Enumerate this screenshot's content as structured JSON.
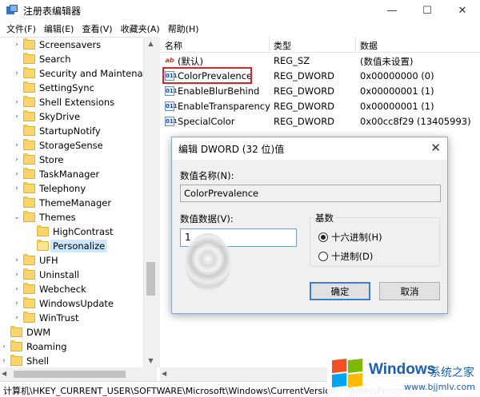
{
  "window": {
    "title": "注册表编辑器",
    "controls": {
      "minimize": "—",
      "maximize": "☐",
      "close": "✕"
    }
  },
  "menu": [
    "文件(F)",
    "编辑(E)",
    "查看(V)",
    "收藏夹(A)",
    "帮助(H)"
  ],
  "tree": {
    "items": [
      {
        "label": "Screensavers",
        "arrow": "›"
      },
      {
        "label": "Search",
        "arrow": ""
      },
      {
        "label": "Security and Maintenance",
        "arrow": "›"
      },
      {
        "label": "SettingSync",
        "arrow": ""
      },
      {
        "label": "Shell Extensions",
        "arrow": "›"
      },
      {
        "label": "SkyDrive",
        "arrow": "›"
      },
      {
        "label": "StartupNotify",
        "arrow": ""
      },
      {
        "label": "StorageSense",
        "arrow": "›"
      },
      {
        "label": "Store",
        "arrow": "›"
      },
      {
        "label": "TaskManager",
        "arrow": "›"
      },
      {
        "label": "Telephony",
        "arrow": "›"
      },
      {
        "label": "ThemeManager",
        "arrow": ""
      },
      {
        "label": "Themes",
        "arrow": "⌄"
      },
      {
        "label": "HighContrast",
        "arrow": ""
      },
      {
        "label": "Personalize",
        "arrow": ""
      },
      {
        "label": "UFH",
        "arrow": "›"
      },
      {
        "label": "Uninstall",
        "arrow": "›"
      },
      {
        "label": "Webcheck",
        "arrow": "›"
      },
      {
        "label": "WindowsUpdate",
        "arrow": "›"
      },
      {
        "label": "WinTrust",
        "arrow": "›"
      },
      {
        "label": "DWM",
        "arrow": ""
      },
      {
        "label": "Roaming",
        "arrow": "›"
      },
      {
        "label": "Shell",
        "arrow": "›"
      }
    ]
  },
  "list": {
    "headers": {
      "name": "名称",
      "type": "类型",
      "data": "数据"
    },
    "rows": [
      {
        "icon": "ab",
        "name": "(默认)",
        "type": "REG_SZ",
        "data": "(数值未设置)"
      },
      {
        "icon": "011",
        "name": "ColorPrevalence",
        "type": "REG_DWORD",
        "data": "0x00000000 (0)"
      },
      {
        "icon": "011",
        "name": "EnableBlurBehind",
        "type": "REG_DWORD",
        "data": "0x00000001 (1)"
      },
      {
        "icon": "011",
        "name": "EnableTransparency",
        "type": "REG_DWORD",
        "data": "0x00000001 (1)"
      },
      {
        "icon": "011",
        "name": "SpecialColor",
        "type": "REG_DWORD",
        "data": "0x00cc8f29 (13405993)"
      }
    ]
  },
  "dialog": {
    "title": "编辑 DWORD (32 位)值",
    "close": "✕",
    "name_label": "数值名称(N):",
    "name_value": "ColorPrevalence",
    "data_label": "数值数据(V):",
    "data_value": "1",
    "base_label": "基数",
    "radio_hex": "十六进制(H)",
    "radio_dec": "十进制(D)",
    "ok": "确定",
    "cancel": "取消"
  },
  "status": "计算机\\HKEY_CURRENT_USER\\SOFTWARE\\Microsoft\\Windows\\CurrentVersion\\Themes\\Personalize",
  "watermark": {
    "brand": "Windows",
    "site": "系统之家",
    "url": "www.bjjmlv.com"
  },
  "colors": {
    "highlight": "#d0262c",
    "selection": "#cce8ff",
    "folder": "#f9d66c",
    "accent": "#3c7fd0"
  }
}
